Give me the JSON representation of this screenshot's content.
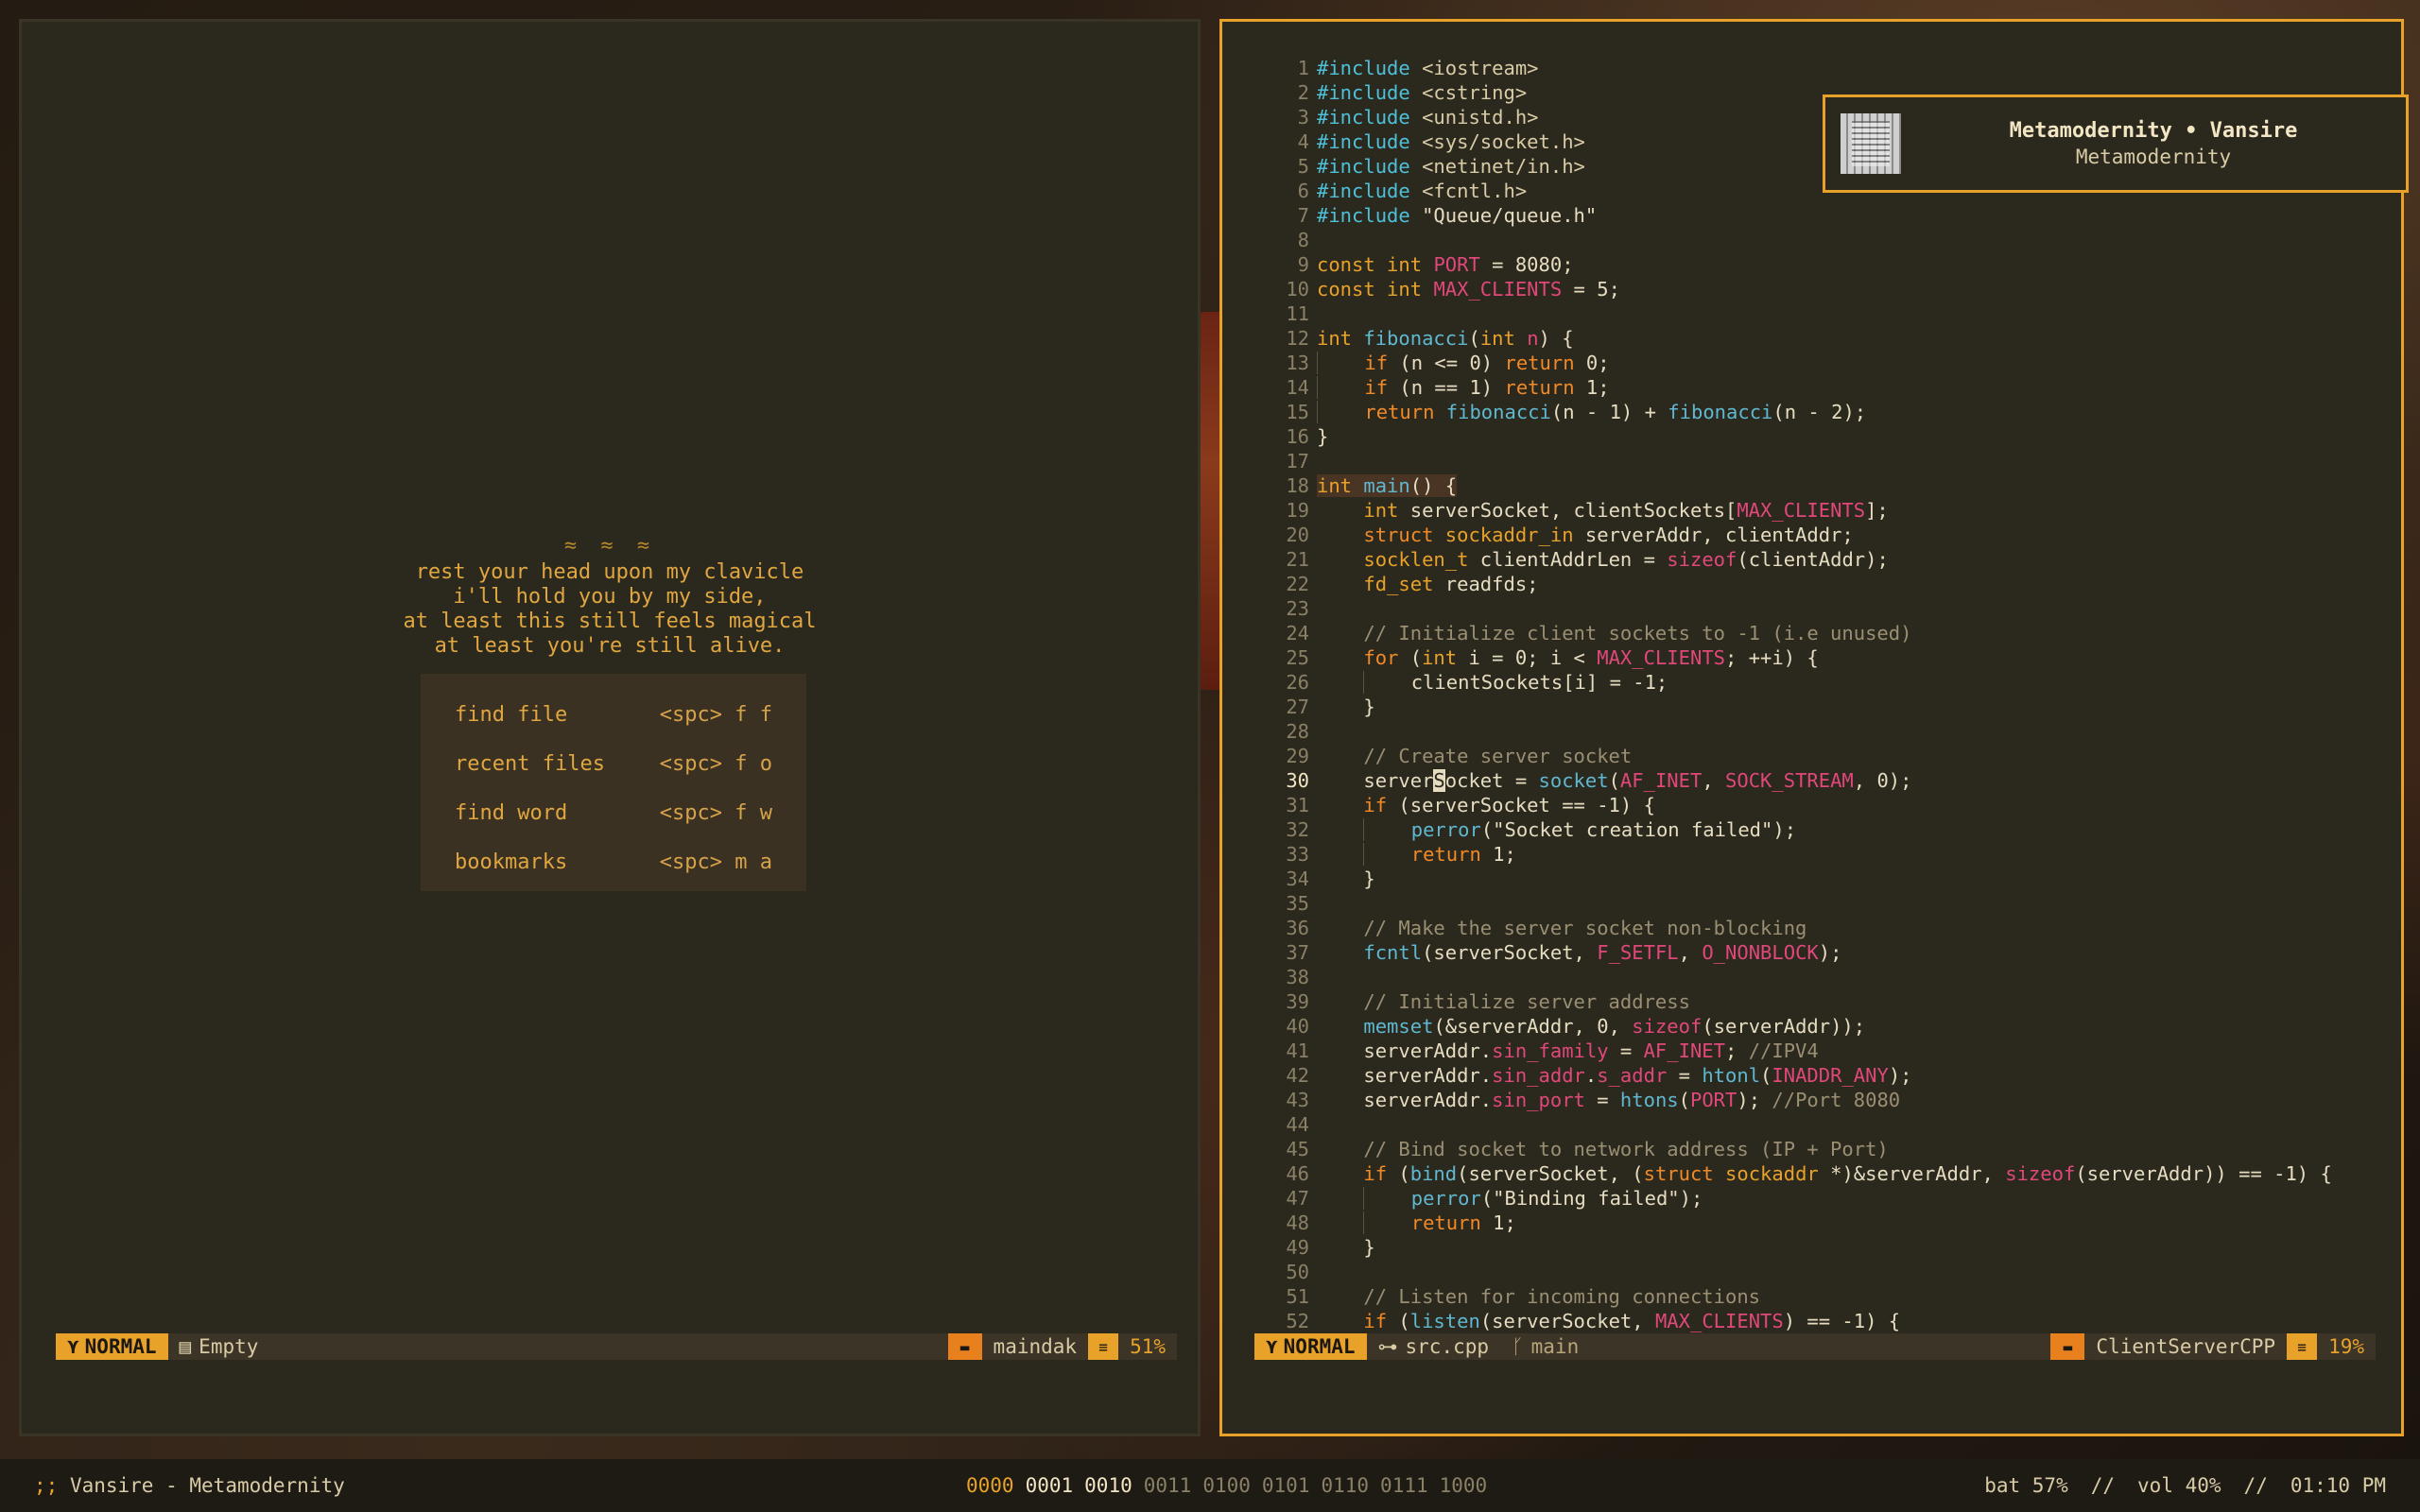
{
  "left_pane": {
    "dashboard": {
      "ornament": "≈ ≈ ≈",
      "quote": [
        "rest your head upon my clavicle",
        "i'll hold you by my side,",
        "at least this still feels magical",
        "at least you're still alive."
      ],
      "menu": [
        {
          "label": "find file",
          "key": "<spc> f f"
        },
        {
          "label": "recent files",
          "key": "<spc> f o"
        },
        {
          "label": "find word",
          "key": "<spc> f w"
        },
        {
          "label": "bookmarks",
          "key": "<spc> m a"
        }
      ]
    },
    "statusline": {
      "mode": "NORMAL",
      "buffer": "Empty",
      "directory": "maindak",
      "percent": "51%"
    }
  },
  "right_pane": {
    "code_lines": [
      "1",
      "2",
      "3",
      "4",
      "5",
      "6",
      "7",
      "8",
      "9",
      "10",
      "11",
      "12",
      "13",
      "14",
      "15",
      "16",
      "17",
      "18",
      "19",
      "20",
      "21",
      "22",
      "23",
      "24",
      "25",
      "26",
      "27",
      "28",
      "29",
      "30",
      "31",
      "32",
      "33",
      "34",
      "35",
      "36",
      "37",
      "38",
      "39",
      "40",
      "41",
      "42",
      "43",
      "44",
      "45",
      "46",
      "47",
      "48",
      "49",
      "50",
      "51",
      "52"
    ],
    "current_line": "30",
    "statusline": {
      "mode": "NORMAL",
      "file": "src.cpp",
      "branch": "main",
      "project": "ClientServerCPP",
      "percent": "19%"
    }
  },
  "notification": {
    "title": "Metamodernity • Vansire",
    "subtitle": "Metamodernity"
  },
  "bottom_bar": {
    "prefix": ";;",
    "now_playing": "Vansire - Metamodernity",
    "workspaces": [
      "0000",
      "0001",
      "0010",
      "0011",
      "0100",
      "0101",
      "0110",
      "0111",
      "1000"
    ],
    "battery": "bat 57%",
    "sep1": "//",
    "volume": "vol 40%",
    "sep2": "//",
    "clock": "01:10 PM"
  },
  "colors": {
    "accent": "#e8a22a",
    "keyword": "#f08a28",
    "function": "#5fb8d0",
    "macro": "#e0487a",
    "background": "#2b281e"
  }
}
